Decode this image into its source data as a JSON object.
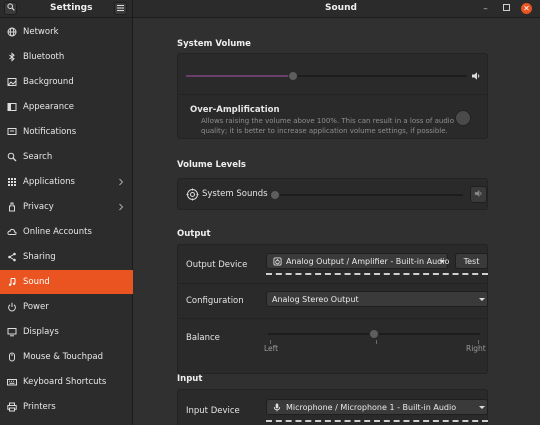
{
  "header": {
    "settings_title": "Settings",
    "page_title": "Sound",
    "search_icon": "search-icon",
    "menu_icon": "hamburger-menu-icon",
    "accent": "#e95420"
  },
  "sidebar": {
    "items": [
      {
        "label": "Network",
        "icon": "network-icon"
      },
      {
        "label": "Bluetooth",
        "icon": "bluetooth-icon"
      },
      {
        "label": "Background",
        "icon": "background-icon"
      },
      {
        "label": "Appearance",
        "icon": "appearance-icon"
      },
      {
        "label": "Notifications",
        "icon": "bell-icon"
      },
      {
        "label": "Search",
        "icon": "search-icon"
      },
      {
        "label": "Applications",
        "icon": "grid-icon"
      },
      {
        "label": "Privacy",
        "icon": "hand-icon"
      },
      {
        "label": "Online Accounts",
        "icon": "cloud-icon"
      },
      {
        "label": "Sharing",
        "icon": "share-icon"
      },
      {
        "label": "Sound",
        "icon": "music-note-icon"
      },
      {
        "label": "Power",
        "icon": "power-icon"
      },
      {
        "label": "Displays",
        "icon": "display-icon"
      },
      {
        "label": "Mouse & Touchpad",
        "icon": "mouse-icon"
      },
      {
        "label": "Keyboard Shortcuts",
        "icon": "keyboard-icon"
      },
      {
        "label": "Printers",
        "icon": "printer-icon"
      }
    ],
    "active": "Sound"
  },
  "system_volume": {
    "title": "System Volume",
    "level": 0.38,
    "over_amp_title": "Over-Amplification",
    "over_amp_desc_line1": "Allows raising the volume above 100%. This can result in a loss of audio",
    "over_amp_desc_line2": "quality; it is better to increase application volume settings, if possible.",
    "over_amp_enabled": false
  },
  "volume_levels": {
    "title": "Volume Levels",
    "system_sounds_label": "System Sounds",
    "system_sounds_level": 0.0
  },
  "output": {
    "title": "Output",
    "device_label": "Output Device",
    "device_value": "Analog Output / Amplifier - Built-in Audio",
    "test_label": "Test",
    "config_label": "Configuration",
    "config_value": "Analog Stereo Output",
    "balance_label": "Balance",
    "balance_value": 0.5,
    "balance_left": "Left",
    "balance_right": "Right"
  },
  "input": {
    "title": "Input",
    "device_label": "Input Device",
    "device_value": "Microphone / Microphone 1 - Built-in Audio"
  }
}
